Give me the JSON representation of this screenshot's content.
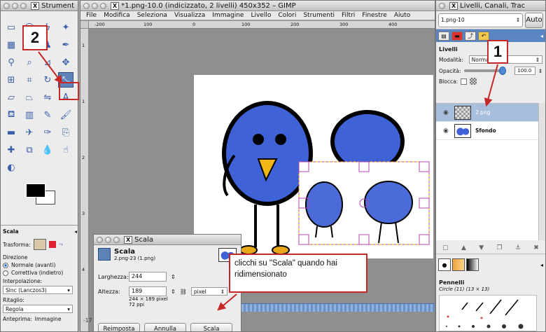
{
  "toolbox": {
    "title": "Strument",
    "tool_icons": [
      "rect-select-icon",
      "ellipse-select-icon",
      "lasso-icon",
      "fuzzy-select-icon",
      "color-select-icon",
      "scissors-icon",
      "fg-select-icon",
      "paths-icon",
      "color-picker-icon",
      "zoom-icon",
      "measure-icon",
      "move-icon",
      "align-icon",
      "crop-icon",
      "rotate-icon",
      "scale-icon",
      "shear-icon",
      "perspective-icon",
      "flip-icon",
      "text-icon",
      "bucket-fill-icon",
      "blend-icon",
      "pencil-icon",
      "paintbrush-icon",
      "eraser-icon",
      "airbrush-icon",
      "ink-icon",
      "clone-icon",
      "heal-icon",
      "perspective-clone-icon",
      "blur-icon",
      "smudge-icon",
      "dodge-burn-icon"
    ],
    "options": {
      "title": "Scala",
      "transform_label": "Trasforma:",
      "direction_label": "Direzione",
      "dir_normal": "Normale (avanti)",
      "dir_corrective": "Correttiva (indietro)",
      "interp_label": "Interpolazione:",
      "interp_value": "Sinc (Lanczos3)",
      "clip_label": "Ritaglio:",
      "clip_value": "Regola",
      "preview_label": "Anteprima:",
      "preview_value": "Immagine"
    }
  },
  "image_window": {
    "title": "*1.png-10.0 (indicizzato, 2 livelli) 450x352 – GIMP",
    "menus": [
      "File",
      "Modifica",
      "Seleziona",
      "Visualizza",
      "Immagine",
      "Livello",
      "Colori",
      "Strumenti",
      "Filtri",
      "Finestre",
      "Aiuto"
    ],
    "ruler_h": [
      "-200",
      "100",
      "0",
      "100",
      "200",
      "300",
      "400",
      "500"
    ],
    "ruler_v": [
      "1",
      "1",
      "2",
      "3",
      "4"
    ],
    "status_left": "-17"
  },
  "layers_dock": {
    "title": "Livelli, Canali, Trac",
    "image_select": "1.png-10",
    "auto_label": "Auto",
    "section_title": "Livelli",
    "mode_label": "Modalità:",
    "mode_value": "Normale",
    "opacity_label": "Opacità:",
    "opacity_value": "100.0",
    "lock_label": "Blocca:",
    "layers": [
      {
        "name": "2.png",
        "selected": true
      },
      {
        "name": "Sfondo",
        "selected": false
      }
    ],
    "brushes_title": "Pennelli",
    "brush_name": "Circle (11) (13 × 13)"
  },
  "scale_dialog": {
    "window_title": "Scala",
    "heading": "Scala",
    "subheading": "2.png-23 (1.png)",
    "width_label": "Larghezza:",
    "width_value": "244",
    "height_label": "Altezza:",
    "height_value": "189",
    "unit_value": "pixel",
    "size_info": "244 × 189 pixel",
    "ppi_info": "72 ppi",
    "btn_reset": "Reimposta",
    "btn_cancel": "Annulla",
    "btn_scale": "Scala"
  },
  "annotations": {
    "num1": "1",
    "num2": "2",
    "note": "clicchi su \"Scala\" quando hai ridimensionato",
    "accent": "#c62828"
  }
}
